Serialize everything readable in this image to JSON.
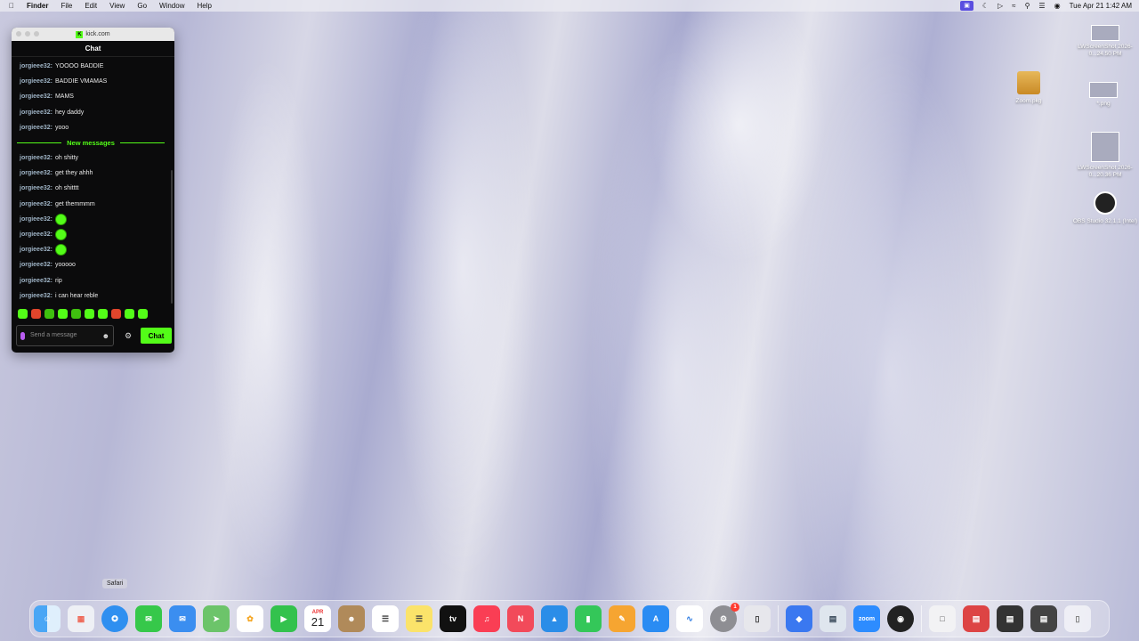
{
  "menubar": {
    "app_name": "Finder",
    "menus": [
      "File",
      "Edit",
      "View",
      "Go",
      "Window",
      "Help"
    ],
    "clock": "Tue Apr 21  1:42 AM"
  },
  "chat_window": {
    "title": "kick.com",
    "header": "Chat",
    "messages_before": [
      {
        "user": "jorgieee32:",
        "text": "YOOOO BADDIE"
      },
      {
        "user": "jorgieee32:",
        "text": "BADDIE VMAMAS"
      },
      {
        "user": "jorgieee32:",
        "text": "MAMS"
      },
      {
        "user": "jorgieee32:",
        "text": "hey daddy"
      },
      {
        "user": "jorgieee32:",
        "text": "yooo"
      }
    ],
    "new_messages_label": "New messages",
    "messages_after": [
      {
        "user": "jorgieee32:",
        "text": "oh shitty"
      },
      {
        "user": "jorgieee32:",
        "text": "get they ahhh"
      },
      {
        "user": "jorgieee32:",
        "text": "oh shitttt"
      },
      {
        "user": "jorgieee32:",
        "text": "get themmmm"
      },
      {
        "user": "jorgieee32:",
        "text": ""
      },
      {
        "user": "jorgieee32:",
        "text": ""
      },
      {
        "user": "jorgieee32:",
        "text": ""
      },
      {
        "user": "jorgieee32:",
        "text": "yooooo"
      },
      {
        "user": "jorgieee32:",
        "text": "rip"
      },
      {
        "user": "jorgieee32:",
        "text": "i can hear reble"
      }
    ],
    "input_placeholder": "Send a message",
    "send_button": "Chat"
  },
  "desktop_icons": [
    {
      "label": "LWScreenShot 2026-0...24.50 PM"
    },
    {
      "label": "Zoom.pkg"
    },
    {
      "label": "*.png"
    },
    {
      "label": "LWScreenShot 2026-0...20.36 PM"
    },
    {
      "label": "OBS Studio 32.1.1 (Intel)"
    }
  ],
  "tooltip": "Safari",
  "dock": {
    "calendar_month": "APR",
    "calendar_day": "21",
    "tv_label": "tv",
    "zoom_label": "zoom",
    "settings_badge": "1"
  },
  "colors": {
    "kick_green": "#53fc18",
    "chat_bg": "#0b0b0c"
  }
}
